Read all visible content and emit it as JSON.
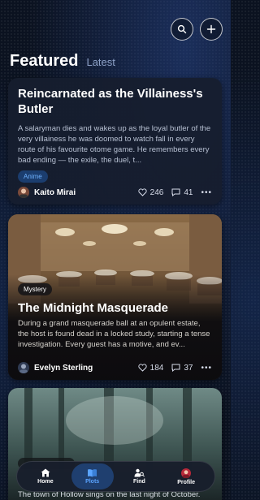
{
  "header": {
    "featured": "Featured",
    "latest": "Latest"
  },
  "toolbar": {
    "search_icon": "search-icon",
    "add_icon": "plus-icon"
  },
  "cards": [
    {
      "title": "Reincarnated as the Villainess's Butler",
      "excerpt": "A salaryman dies and wakes up as the loyal butler of the very villainess he was doomed to watch fall in every route of his favourite otome game. He remembers every bad ending — the exile, the duel, t...",
      "tag": "Anime",
      "author": "Kaito Mirai",
      "likes": "246",
      "comments": "41",
      "more": "•••"
    },
    {
      "genre": "Mystery",
      "title": "The Midnight Masquerade",
      "excerpt": "During a grand masquerade ball at an opulent estate, the host is found dead in a locked study, starting a tense investigation. Every guest has a motive, and ev...",
      "author": "Evelyn Sterling",
      "likes": "184",
      "comments": "37",
      "more": "•••"
    },
    {
      "excerpt": "The town of Hollow sings on the last night of October."
    }
  ],
  "nav": [
    {
      "label": "Home",
      "icon": "home-icon",
      "active": false
    },
    {
      "label": "Plots",
      "icon": "book-icon",
      "active": true
    },
    {
      "label": "Find",
      "icon": "find-user-icon",
      "active": false
    },
    {
      "label": "Profile",
      "icon": "avatar",
      "active": false
    }
  ],
  "colors": {
    "accent": "#5aa4ff",
    "tag_bg": "#1b3d6e",
    "background": "#0b1220"
  }
}
